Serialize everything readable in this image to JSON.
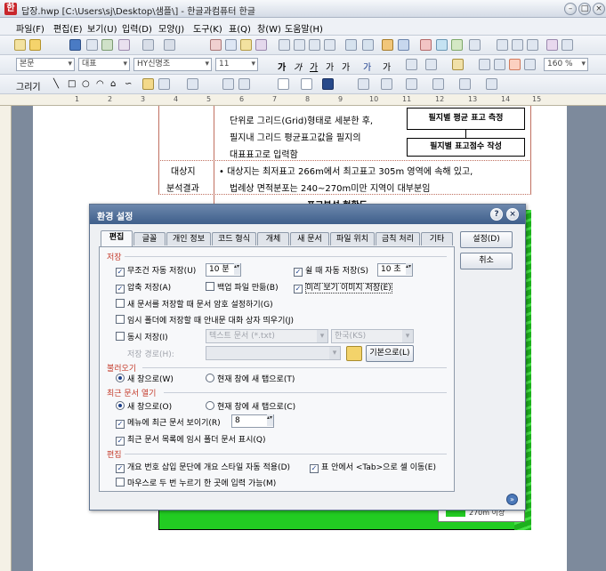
{
  "window": {
    "title": "답장.hwp [C:\\Users\\sj\\Desktop\\샘플\\] - 한글과컴퓨터 한글",
    "app_icon": "한"
  },
  "menu": [
    "파일(F)",
    "편집(E)",
    "보기(U)",
    "입력(D)",
    "모양(J)",
    "도구(K)",
    "표(Q)",
    "창(W)",
    "도움말(H)"
  ],
  "format_toolbar": {
    "style": "본문",
    "font_lang": "대표",
    "font": "HY신명조",
    "size": "11",
    "zoom": "160 %"
  },
  "draw_toolbar": {
    "label": "그리기"
  },
  "ruler_numbers": [
    "1",
    "2",
    "3",
    "4",
    "5",
    "6",
    "7",
    "8",
    "9",
    "10",
    "11",
    "12",
    "13",
    "14",
    "15"
  ],
  "document": {
    "line1": "단위로 그리드(Grid)형태로 세분한 후,",
    "line2": "필지내 그리드 평균표고값을 필지의",
    "line3": "대표표고로 입력함",
    "box1": "필지별 평균 표고 측정",
    "box2": "필지별 표고점수 작성",
    "row2_label1": "대상지",
    "row2_label2": "분석결과",
    "row2_line1": "• 대상지는 최저표고 266m에서 최고표고 305m 영역에 속해 있고,",
    "row2_line2": "법례상 면적분포는 240~270m미만 지역이 대부분임",
    "heading": "표고분석 현황도",
    "legend_label": "270m 이상"
  },
  "dialog": {
    "title": "환경 설정",
    "help_icon": "?",
    "close_icon": "×",
    "tabs": [
      "편집",
      "글꼴",
      "개인 정보",
      "코드 형식",
      "개체",
      "새 문서",
      "파일 위치",
      "금칙 처리",
      "기타"
    ],
    "sections": {
      "save": "저장",
      "open": "불러오기",
      "recent": "최근 문서 열기",
      "edit": "편집"
    },
    "save": {
      "autosave_label": "무조건 자동 저장(U)",
      "autosave_value": "10 분",
      "idle_save_label": "쉴 때 자동 저장(S)",
      "idle_save_value": "10 초",
      "compress_label": "압축 저장(A)",
      "backup_label": "백업 파일 만듦(B)",
      "preview_label": "미리 보기 이미지 저장(E)",
      "password_label": "새 문서를 저장할 때 문서 암호 설정하기(G)",
      "temp_folder_label": "임시 폴더에 저장할 때 안내문 대화 상자 띄우기(J)",
      "simultaneous_label": "동시 저장(I)",
      "simultaneous_format": "텍스트 문서 (*.txt)",
      "simultaneous_encoding": "한국(KS)",
      "path_label": "저장 경로(H):",
      "path_value": "",
      "default_button": "기본으로(L)"
    },
    "open": {
      "new_tab": "새 창으로(W)",
      "current_tab": "현재 창에 새 탭으로(T)"
    },
    "recent": {
      "new_tab": "새 창으로(O)",
      "current_tab": "현재 창에 새 탭으로(C)",
      "show_menu_label": "메뉴에 최근 문서 보이기(R)",
      "show_menu_value": "8",
      "show_temp_label": "최근 문서 목록에 임시 폴더 문서 표시(Q)"
    },
    "edit": {
      "numbering_style_label": "개요 번호 삽입 문단에 개요 스타일 자동 적용(D)",
      "tab_move_label": "표 안에서 <Tab>으로 셀 이동(E)",
      "double_click_label": "마우스로 두 번 누르기 한 곳에 입력 가능(M)"
    },
    "buttons": {
      "ok": "설정(D)",
      "cancel": "취소"
    },
    "colors": {
      "section_title": "#c43c2c",
      "title_bar": "#3f5f8b",
      "map_green": "#22cc22"
    }
  }
}
